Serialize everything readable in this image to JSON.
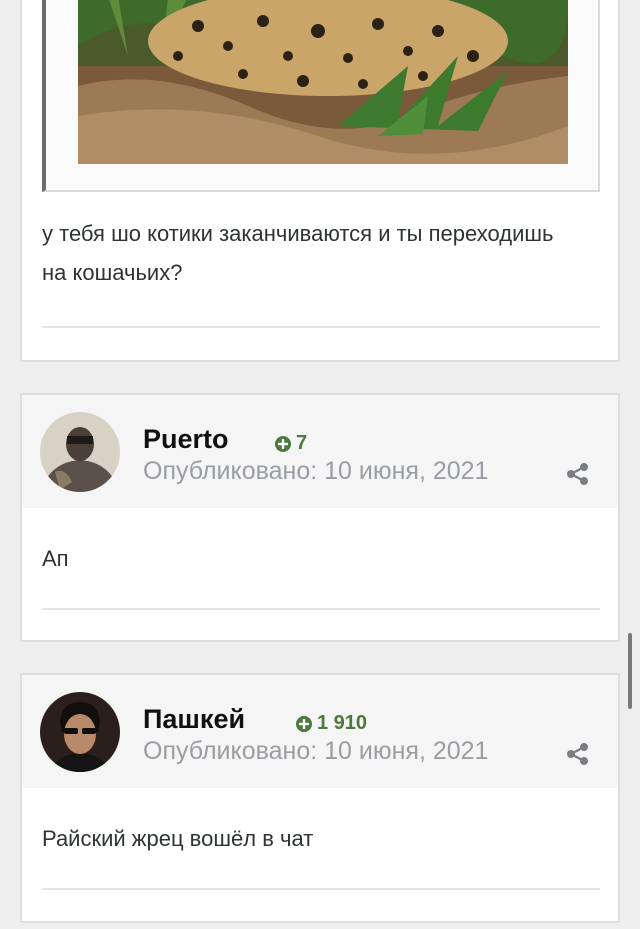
{
  "posts": [
    {
      "quote_image": "leopard-photo",
      "text": "у тебя шо котики заканчиваются и ты переходишь на кошачьих?"
    },
    {
      "author": "Puerto",
      "reputation": "7",
      "published": "Опубликовано: 10 июня, 2021",
      "text": "Ап",
      "avatar": "avatar-puerto"
    },
    {
      "author": "Пашкей",
      "reputation": "1 910",
      "published": "Опубликовано: 10 июня, 2021",
      "text": "Райский жрец вошёл в чат",
      "avatar": "avatar-pashkey"
    }
  ],
  "icons": {
    "reputation": "plus-circle-icon",
    "share": "share-icon"
  },
  "colors": {
    "reputation": "#4b7a3c",
    "meta": "#9a9da2",
    "header_bg": "#f5f5f5"
  }
}
